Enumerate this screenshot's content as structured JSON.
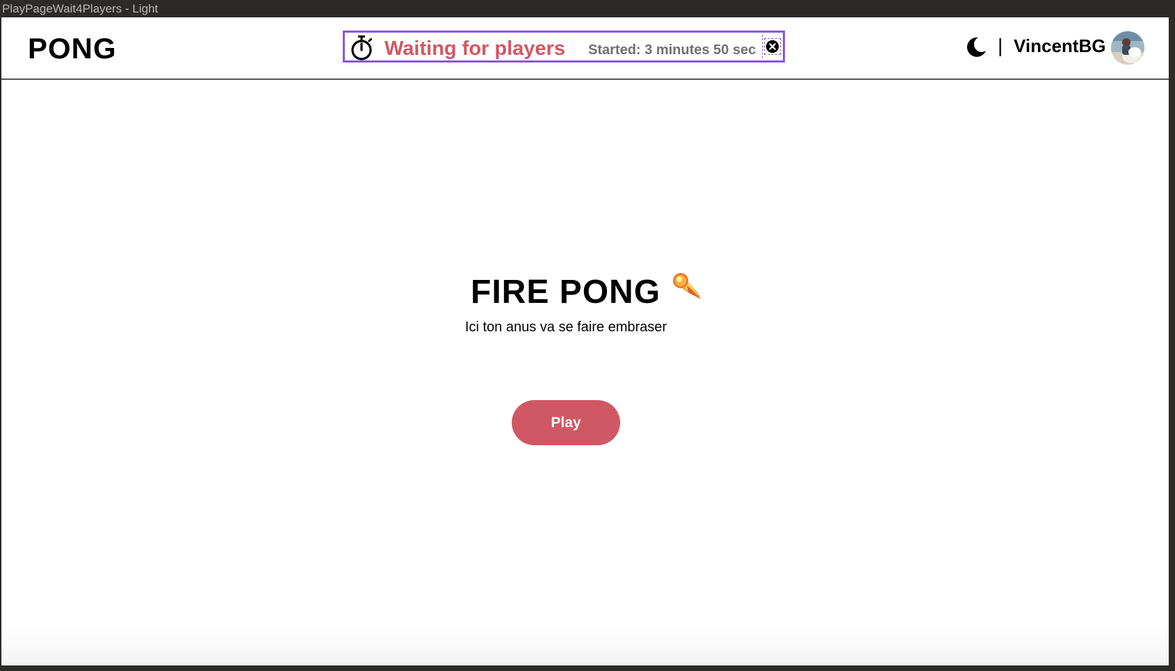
{
  "window": {
    "title": "PlayPageWait4Players - Light"
  },
  "header": {
    "logo": "PONG",
    "banner": {
      "status": "Waiting for players",
      "elapsed": "Started: 3 minutes  50 sec",
      "accent_color": "#d05864",
      "border_color": "#8a55e0"
    },
    "theme_toggle_icon": "moon-icon",
    "divider": "|",
    "username": "VincentBG"
  },
  "main": {
    "title": "FIRE PONG",
    "title_icon": "fireball-icon",
    "subtitle": "Ici ton anus va se faire embraser",
    "play_button": "Play",
    "button_color": "#d05864"
  }
}
